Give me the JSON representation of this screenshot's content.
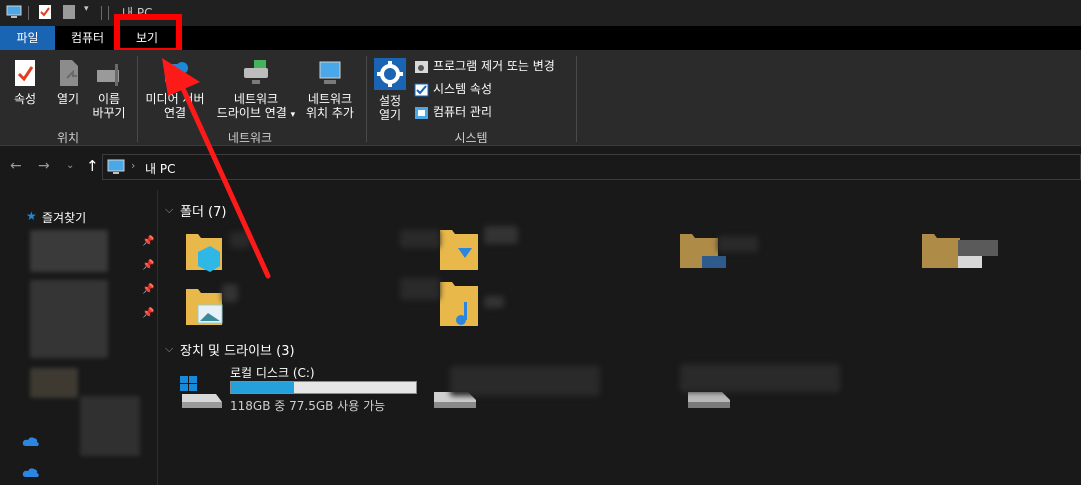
{
  "window": {
    "title": "내 PC"
  },
  "ribbon_tabs": [
    {
      "label": "파일"
    },
    {
      "label": "컴퓨터"
    },
    {
      "label": "보기"
    }
  ],
  "ribbon": {
    "location_group": {
      "label": "위치",
      "properties": "속성",
      "open": "열기",
      "rename_line1": "이름",
      "rename_line2": "바꾸기"
    },
    "network_group": {
      "label": "네트워크",
      "media_line1": "미디어 서버",
      "media_line2": "연결",
      "map_drive_line1": "네트워크",
      "map_drive_line2": "드라이브 연결",
      "add_location_line1": "네트워크",
      "add_location_line2": "위치 추가"
    },
    "system_group": {
      "label": "시스템",
      "settings_line1": "설정",
      "settings_line2": "열기",
      "uninstall": "프로그램 제거 또는 변경",
      "system_properties": "시스템 속성",
      "computer_management": "컴퓨터 관리"
    }
  },
  "address": {
    "path": "내 PC"
  },
  "sidebar": {
    "quick_access": "즐겨찾기"
  },
  "main": {
    "folders_header": "폴더 (7)",
    "devices_header": "장치 및 드라이브 (3)",
    "drive_c": {
      "name": "로컬 디스크 (C:)",
      "space": "118GB 중 77.5GB 사용 가능",
      "used_fraction": 0.34
    }
  },
  "colors": {
    "accent": "#1a64b4",
    "highlight": "#ff0000",
    "drive_bar": "#26a0da"
  }
}
